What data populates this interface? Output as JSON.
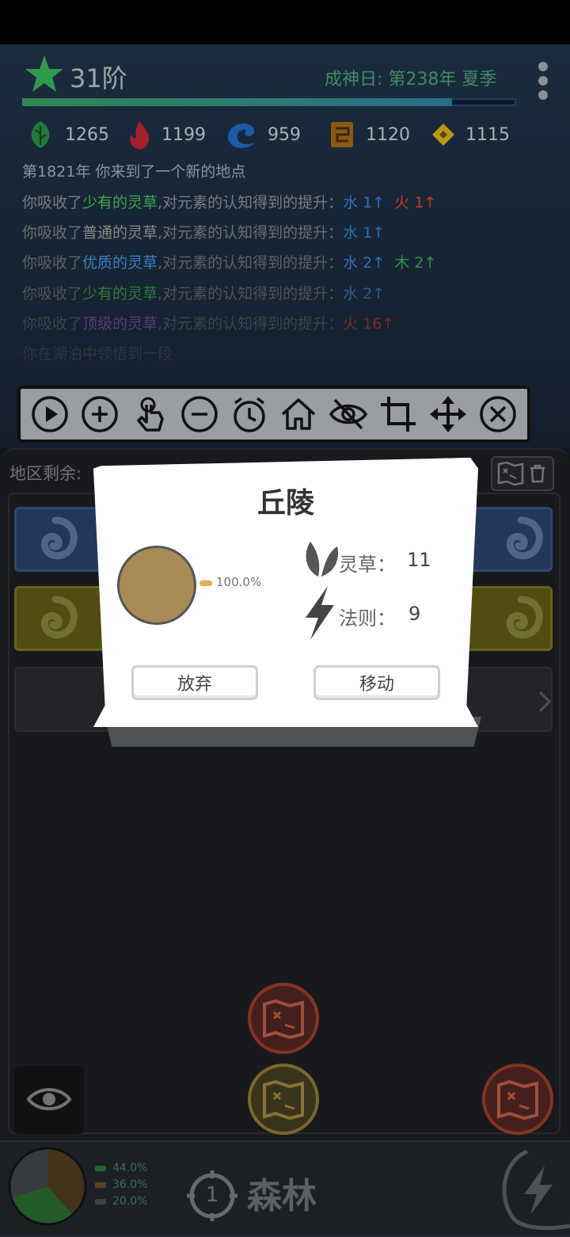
{
  "header": {
    "rank": "31阶",
    "date": "成神日: 第238年 夏季",
    "progress": 0.87
  },
  "resources": [
    {
      "name": "wood",
      "value": "1265",
      "color": "#1f7a3c"
    },
    {
      "name": "fire",
      "value": "1199",
      "color": "#a3202a"
    },
    {
      "name": "water",
      "value": "959",
      "color": "#1f5aa8"
    },
    {
      "name": "earth",
      "value": "1120",
      "color": "#8a5a14"
    },
    {
      "name": "metal",
      "value": "1115",
      "color": "#b7981a"
    }
  ],
  "log": {
    "line1": "第1821年 你来到了一个新的地点",
    "lines": [
      {
        "prefix": "你吸收了",
        "herb": "少有的灵草",
        "herb_color": "#3fa34a",
        "mid": ",对元素的认知得到的提升：",
        "gains": [
          {
            "text": "水 1↑",
            "color": "#2f6fb8"
          },
          {
            "text": "火 1↑",
            "color": "#c0392b"
          }
        ]
      },
      {
        "prefix": "你吸收了",
        "herb": "普通的灵草",
        "herb_color": "#8a8a8a",
        "mid": ",对元素的认知得到的提升：",
        "gains": [
          {
            "text": "水 1↑",
            "color": "#2f6fb8"
          }
        ]
      },
      {
        "prefix": "你吸收了",
        "herb": "优质的灵草",
        "herb_color": "#3a7fc0",
        "mid": ",对元素的认知得到的提升：",
        "gains": [
          {
            "text": "水 2↑",
            "color": "#2f6fb8"
          },
          {
            "text": "木 2↑",
            "color": "#2f8f4a"
          }
        ]
      },
      {
        "prefix": "你吸收了",
        "herb": "少有的灵草",
        "herb_color": "#3fa34a",
        "mid": ",对元素的认知得到的提升：",
        "gains": [
          {
            "text": "水 2↑",
            "color": "#2f6fb8"
          }
        ]
      },
      {
        "prefix": "你吸收了",
        "herb": "顶级的灵草",
        "herb_color": "#7a4fa0",
        "mid": ",对元素的认知得到的提升：",
        "gains": [
          {
            "text": "火 16↑",
            "color": "#c0392b"
          }
        ]
      }
    ],
    "last": "你在湖泊中领悟到一段"
  },
  "toolbar": {
    "tools": [
      "play-icon",
      "zoom-in-icon",
      "tap-icon",
      "zoom-out-icon",
      "alarm-icon",
      "home-icon",
      "hide-icon",
      "crop-icon",
      "move-icon",
      "close-icon"
    ]
  },
  "panel": {
    "region_label": "地区剩余:"
  },
  "popup": {
    "title": "丘陵",
    "pie_pct": "100.0%",
    "pie_color": "#a98a56",
    "herb_label": "灵草：",
    "herb_value": "11",
    "law_label": "法则：",
    "law_value": "9",
    "abandon": "放弃",
    "move": "移动"
  },
  "bottom": {
    "legend": [
      {
        "pct": "44.0%",
        "color": "#2f8a3a"
      },
      {
        "pct": "36.0%",
        "color": "#7a5a2a"
      },
      {
        "pct": "20.0%",
        "color": "#555a60"
      }
    ],
    "region_number": "1",
    "region_name": "森林"
  }
}
